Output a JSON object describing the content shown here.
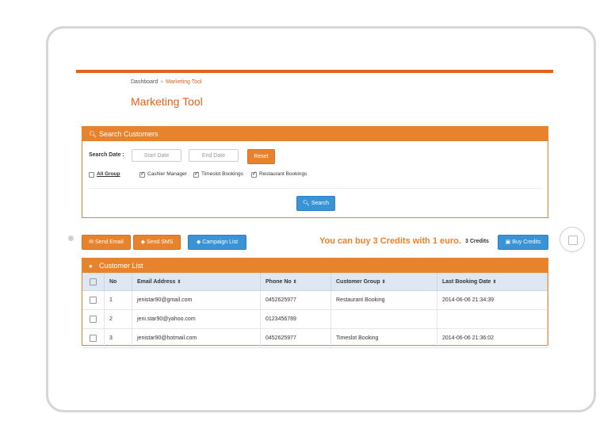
{
  "breadcrumb": {
    "home": "Dashboard",
    "separator": "»",
    "current": "Marketing Tool"
  },
  "page_title": "Marketing Tool",
  "search_panel": {
    "title": "Search Customers",
    "search_date_label": "Search Date :",
    "start_placeholder": "Start Date",
    "end_placeholder": "End Date",
    "reset_label": "Reset",
    "all_group_label": "All Group",
    "groups": [
      {
        "label": "Cashier Manager",
        "checked": true
      },
      {
        "label": "Timeslot Bookings",
        "checked": true
      },
      {
        "label": "Restaurant Bookings",
        "checked": true
      }
    ],
    "search_label": "Search"
  },
  "actions": {
    "send_email": "Send Email",
    "send_sms": "Send SMS",
    "campaign_list": "Campaign List",
    "credit_message": "You can buy 3 Credits with 1 euro.",
    "credits": "3 Credits",
    "buy_credits": "Buy Credits"
  },
  "customer_list": {
    "title": "Customer List",
    "columns": [
      "No",
      "Email Address",
      "Phone No",
      "Customer Group",
      "Last Booking Date"
    ],
    "rows": [
      {
        "no": "1",
        "email": "jenistar90@gmail.com",
        "phone": "0452625977",
        "group": "Restaurant Booking",
        "date": "2014-06-06 21:34:39"
      },
      {
        "no": "2",
        "email": "jeni.star90@yahoo.com",
        "phone": "0123456789",
        "group": "",
        "date": ""
      },
      {
        "no": "3",
        "email": "jenistar90@hotmail.com",
        "phone": "0452625977",
        "group": "Timeslot Booking",
        "date": "2014-06-06 21:36:02"
      }
    ]
  },
  "colors": {
    "accent": "#e8832d",
    "topbar": "#e0621b",
    "primary": "#3a93d6"
  },
  "icons": [
    "search-icon",
    "user-icon",
    "envelope-icon",
    "tag-icon",
    "money-icon",
    "sort-icon"
  ]
}
